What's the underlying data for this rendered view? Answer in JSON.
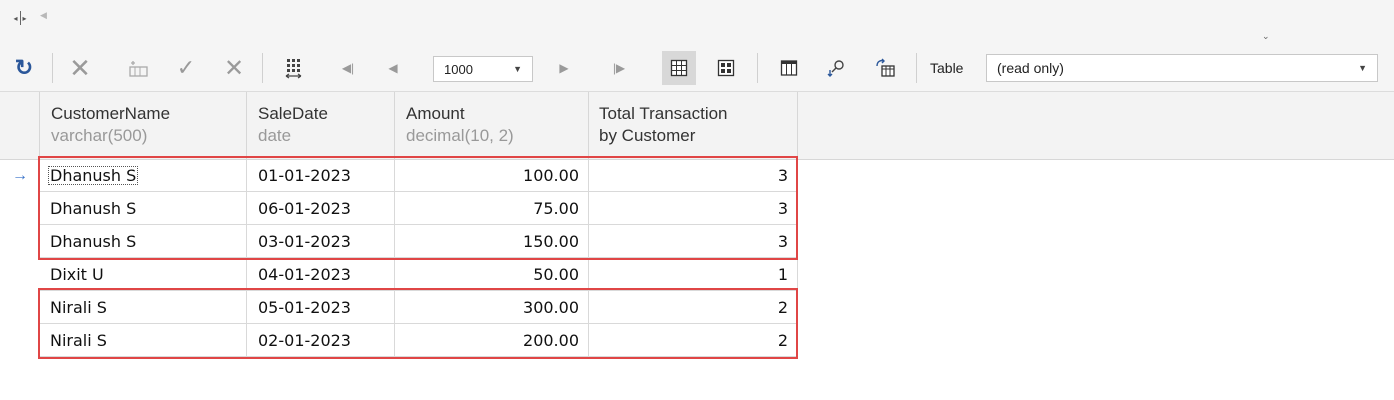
{
  "toolbar": {
    "rows_per_page": "1000",
    "mode_label": "Table",
    "mode_value": "(read only)"
  },
  "grid": {
    "columns": [
      {
        "name": "CustomerName",
        "type": "varchar(500)"
      },
      {
        "name": "SaleDate",
        "type": "date"
      },
      {
        "name": "Amount",
        "type": "decimal(10, 2)"
      },
      {
        "name": "Total Transaction",
        "type": "by Customer"
      }
    ],
    "rows": [
      {
        "indicator": "→",
        "customer": "Dhanush S",
        "date": "01-01-2023",
        "amount": "100.00",
        "total": "3"
      },
      {
        "indicator": "",
        "customer": "Dhanush S",
        "date": "06-01-2023",
        "amount": "75.00",
        "total": "3"
      },
      {
        "indicator": "",
        "customer": "Dhanush S",
        "date": "03-01-2023",
        "amount": "150.00",
        "total": "3"
      },
      {
        "indicator": "",
        "customer": "Dixit U",
        "date": "04-01-2023",
        "amount": "50.00",
        "total": "1"
      },
      {
        "indicator": "",
        "customer": "Nirali S",
        "date": "05-01-2023",
        "amount": "300.00",
        "total": "2"
      },
      {
        "indicator": "",
        "customer": "Nirali S",
        "date": "02-01-2023",
        "amount": "200.00",
        "total": "2"
      }
    ]
  },
  "colors": {
    "highlight": "#e04646",
    "accent": "#2b579a",
    "indicator": "#3a73c9"
  }
}
